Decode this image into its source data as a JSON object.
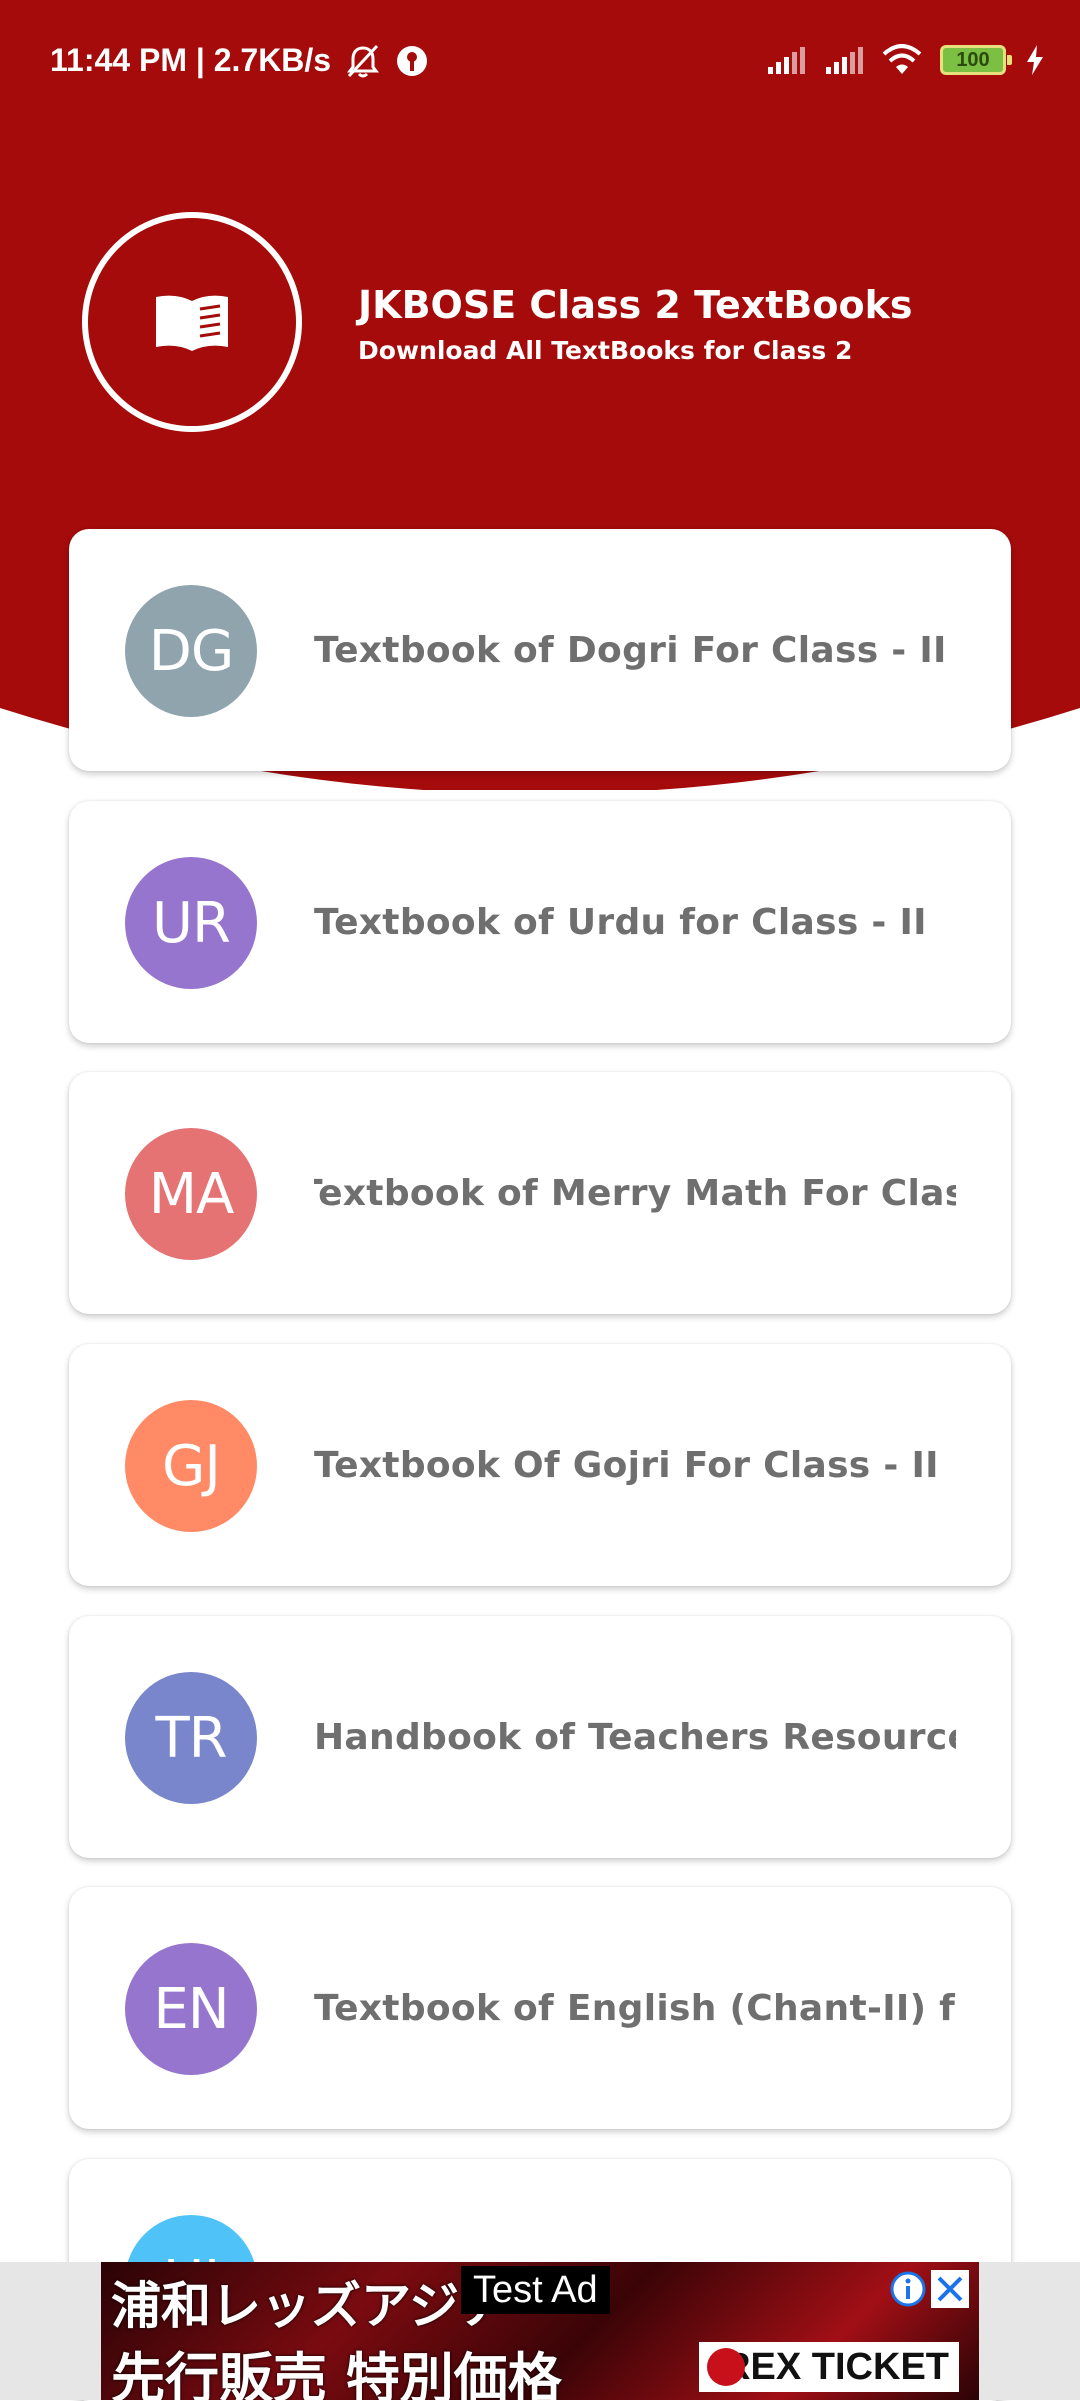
{
  "status_bar": {
    "time_speed": "11:44 PM | 2.7KB/s",
    "battery": "100",
    "icons": [
      "muted-alarm-icon",
      "vpn-icon",
      "signal-icon",
      "signal-icon",
      "wifi-icon",
      "battery-icon",
      "charging-icon"
    ]
  },
  "header": {
    "title": "JKBOSE Class 2 TextBooks",
    "subtitle": "Download All TextBooks for Class 2",
    "logo_icon": "open-book-icon",
    "background_color": "#a50b0b"
  },
  "books": [
    {
      "initials": "DG",
      "title": "Textbook of Dogri For Class - II",
      "color": "#90a4ae"
    },
    {
      "initials": "UR",
      "title": "Textbook of Urdu for Class - II",
      "color": "#9575cd"
    },
    {
      "initials": "MA",
      "title": "Textbook of Merry Math For Class - II",
      "color": "#e57373"
    },
    {
      "initials": "GJ",
      "title": "Textbook Of Gojri For Class - II",
      "color": "#ff8a65"
    },
    {
      "initials": "TR",
      "title": "Handbook of Teachers Resources Class - II",
      "color": "#7986cb"
    },
    {
      "initials": "EN",
      "title": "Textbook of English (Chant-II) for Class - II",
      "color": "#9575cd"
    },
    {
      "initials": "HI",
      "title": "",
      "color": "#4fc3f7"
    }
  ],
  "ad": {
    "label": "Test Ad",
    "line1": "浦和レッズアジア",
    "line2": "先行販売 特別価格",
    "brand": "REX TICKET"
  }
}
